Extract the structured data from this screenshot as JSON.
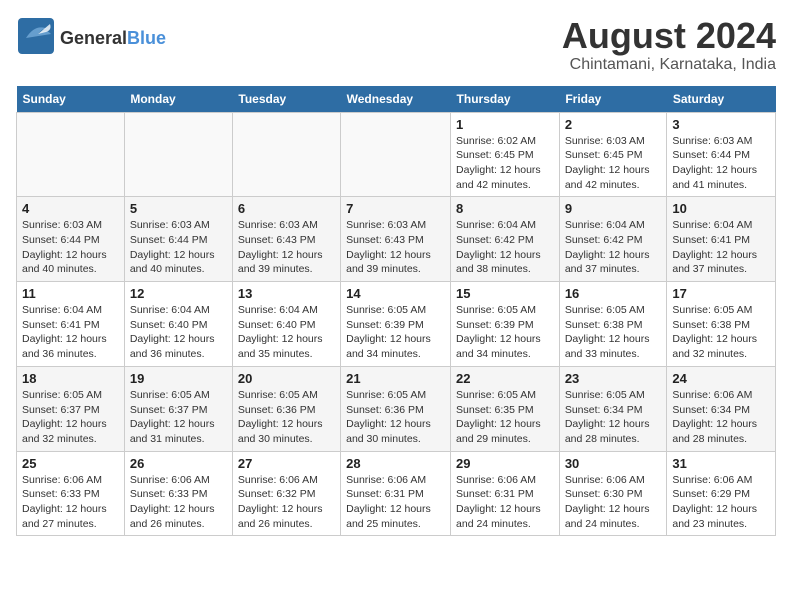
{
  "header": {
    "logo_general": "General",
    "logo_blue": "Blue",
    "month_year": "August 2024",
    "location": "Chintamani, Karnataka, India"
  },
  "days_of_week": [
    "Sunday",
    "Monday",
    "Tuesday",
    "Wednesday",
    "Thursday",
    "Friday",
    "Saturday"
  ],
  "weeks": [
    [
      {
        "num": "",
        "info": "",
        "empty": true
      },
      {
        "num": "",
        "info": "",
        "empty": true
      },
      {
        "num": "",
        "info": "",
        "empty": true
      },
      {
        "num": "",
        "info": "",
        "empty": true
      },
      {
        "num": "1",
        "info": "Sunrise: 6:02 AM\nSunset: 6:45 PM\nDaylight: 12 hours\nand 42 minutes."
      },
      {
        "num": "2",
        "info": "Sunrise: 6:03 AM\nSunset: 6:45 PM\nDaylight: 12 hours\nand 42 minutes."
      },
      {
        "num": "3",
        "info": "Sunrise: 6:03 AM\nSunset: 6:44 PM\nDaylight: 12 hours\nand 41 minutes."
      }
    ],
    [
      {
        "num": "4",
        "info": "Sunrise: 6:03 AM\nSunset: 6:44 PM\nDaylight: 12 hours\nand 40 minutes."
      },
      {
        "num": "5",
        "info": "Sunrise: 6:03 AM\nSunset: 6:44 PM\nDaylight: 12 hours\nand 40 minutes."
      },
      {
        "num": "6",
        "info": "Sunrise: 6:03 AM\nSunset: 6:43 PM\nDaylight: 12 hours\nand 39 minutes."
      },
      {
        "num": "7",
        "info": "Sunrise: 6:03 AM\nSunset: 6:43 PM\nDaylight: 12 hours\nand 39 minutes."
      },
      {
        "num": "8",
        "info": "Sunrise: 6:04 AM\nSunset: 6:42 PM\nDaylight: 12 hours\nand 38 minutes."
      },
      {
        "num": "9",
        "info": "Sunrise: 6:04 AM\nSunset: 6:42 PM\nDaylight: 12 hours\nand 37 minutes."
      },
      {
        "num": "10",
        "info": "Sunrise: 6:04 AM\nSunset: 6:41 PM\nDaylight: 12 hours\nand 37 minutes."
      }
    ],
    [
      {
        "num": "11",
        "info": "Sunrise: 6:04 AM\nSunset: 6:41 PM\nDaylight: 12 hours\nand 36 minutes."
      },
      {
        "num": "12",
        "info": "Sunrise: 6:04 AM\nSunset: 6:40 PM\nDaylight: 12 hours\nand 36 minutes."
      },
      {
        "num": "13",
        "info": "Sunrise: 6:04 AM\nSunset: 6:40 PM\nDaylight: 12 hours\nand 35 minutes."
      },
      {
        "num": "14",
        "info": "Sunrise: 6:05 AM\nSunset: 6:39 PM\nDaylight: 12 hours\nand 34 minutes."
      },
      {
        "num": "15",
        "info": "Sunrise: 6:05 AM\nSunset: 6:39 PM\nDaylight: 12 hours\nand 34 minutes."
      },
      {
        "num": "16",
        "info": "Sunrise: 6:05 AM\nSunset: 6:38 PM\nDaylight: 12 hours\nand 33 minutes."
      },
      {
        "num": "17",
        "info": "Sunrise: 6:05 AM\nSunset: 6:38 PM\nDaylight: 12 hours\nand 32 minutes."
      }
    ],
    [
      {
        "num": "18",
        "info": "Sunrise: 6:05 AM\nSunset: 6:37 PM\nDaylight: 12 hours\nand 32 minutes."
      },
      {
        "num": "19",
        "info": "Sunrise: 6:05 AM\nSunset: 6:37 PM\nDaylight: 12 hours\nand 31 minutes."
      },
      {
        "num": "20",
        "info": "Sunrise: 6:05 AM\nSunset: 6:36 PM\nDaylight: 12 hours\nand 30 minutes."
      },
      {
        "num": "21",
        "info": "Sunrise: 6:05 AM\nSunset: 6:36 PM\nDaylight: 12 hours\nand 30 minutes."
      },
      {
        "num": "22",
        "info": "Sunrise: 6:05 AM\nSunset: 6:35 PM\nDaylight: 12 hours\nand 29 minutes."
      },
      {
        "num": "23",
        "info": "Sunrise: 6:05 AM\nSunset: 6:34 PM\nDaylight: 12 hours\nand 28 minutes."
      },
      {
        "num": "24",
        "info": "Sunrise: 6:06 AM\nSunset: 6:34 PM\nDaylight: 12 hours\nand 28 minutes."
      }
    ],
    [
      {
        "num": "25",
        "info": "Sunrise: 6:06 AM\nSunset: 6:33 PM\nDaylight: 12 hours\nand 27 minutes."
      },
      {
        "num": "26",
        "info": "Sunrise: 6:06 AM\nSunset: 6:33 PM\nDaylight: 12 hours\nand 26 minutes."
      },
      {
        "num": "27",
        "info": "Sunrise: 6:06 AM\nSunset: 6:32 PM\nDaylight: 12 hours\nand 26 minutes."
      },
      {
        "num": "28",
        "info": "Sunrise: 6:06 AM\nSunset: 6:31 PM\nDaylight: 12 hours\nand 25 minutes."
      },
      {
        "num": "29",
        "info": "Sunrise: 6:06 AM\nSunset: 6:31 PM\nDaylight: 12 hours\nand 24 minutes."
      },
      {
        "num": "30",
        "info": "Sunrise: 6:06 AM\nSunset: 6:30 PM\nDaylight: 12 hours\nand 24 minutes."
      },
      {
        "num": "31",
        "info": "Sunrise: 6:06 AM\nSunset: 6:29 PM\nDaylight: 12 hours\nand 23 minutes."
      }
    ]
  ]
}
